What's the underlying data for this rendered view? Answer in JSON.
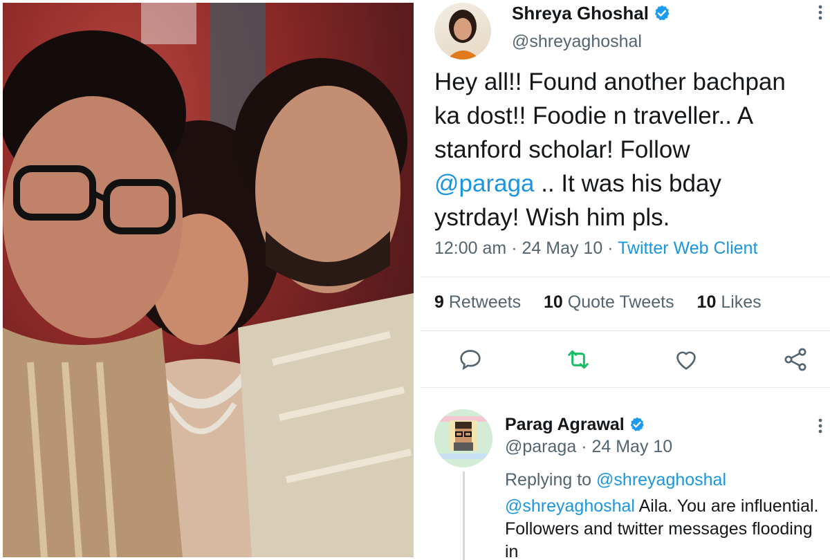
{
  "tweet": {
    "author_name": "Shreya Ghoshal",
    "author_handle": "@shreyaghoshal",
    "text_line1": "Hey all!! Found another bachpan",
    "text_line2": "ka dost!! Foodie n traveller.. A",
    "text_line3": "stanford scholar! Follow",
    "text_mention": "@paraga",
    "text_line4_rest": " .. It was his bday",
    "text_line5": "ystrday! Wish him pls.",
    "time": "12:00 am",
    "date": "24 May 10",
    "separator": "·",
    "client": "Twitter Web Client",
    "retweets_count": "9",
    "retweets_label": "Retweets",
    "quote_count": "10",
    "quote_label": "Quote Tweets",
    "likes_count": "10",
    "likes_label": "Likes"
  },
  "reply": {
    "author_name": "Parag Agrawal",
    "author_handle": "@paraga",
    "date": "24 May 10",
    "separator": "·",
    "replying_label": "Replying to",
    "replying_to": "@shreyaghoshal",
    "mention": "@shreyaghoshal",
    "text_line1_rest": " Aila. You are influential.",
    "text_line2": "Followers and twitter messages flooding",
    "text_line3": "in"
  },
  "colors": {
    "link": "#1b95e0",
    "verified": "#1d9bf0",
    "retweet_green": "#17bf63",
    "text_secondary": "#536471"
  },
  "icons": [
    "verified-badge-icon",
    "more-icon",
    "reply-icon",
    "retweet-icon",
    "like-icon",
    "share-icon"
  ]
}
